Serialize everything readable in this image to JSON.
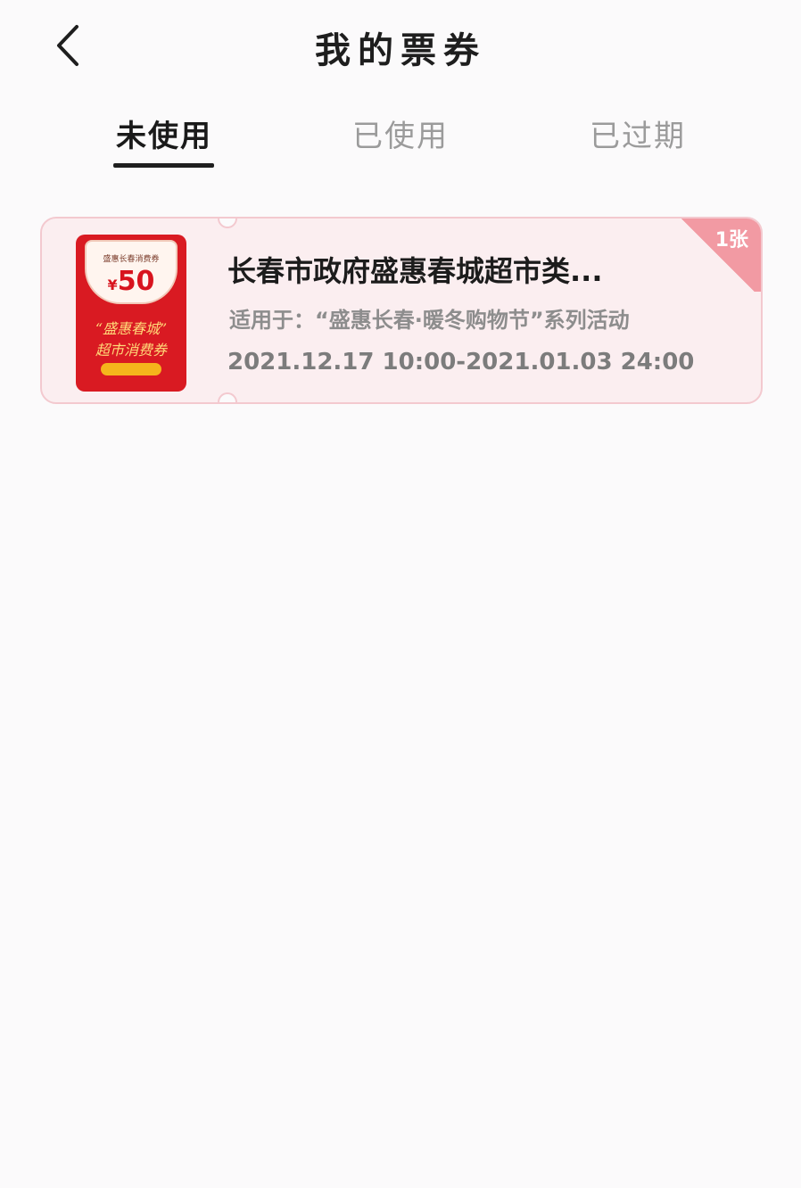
{
  "header": {
    "title": "我的票券",
    "back_icon": "chevron-left-icon"
  },
  "tabs": [
    {
      "label": "未使用",
      "active": true
    },
    {
      "label": "已使用",
      "active": false
    },
    {
      "label": "已过期",
      "active": false
    }
  ],
  "tickets": [
    {
      "title": "长春市政府盛惠春城超市类...",
      "scope_label": "适用于：",
      "scope": "“盛惠长春·暖冬购物节”系列活动",
      "date_range": "2021.12.17 10:00-2021.01.03 24:00",
      "count_badge": "1张",
      "image": {
        "header_text": "盛惠长春消费券",
        "amount": "50",
        "currency": "¥",
        "line1": "“盛惠春城”",
        "line2": "超市消费券"
      }
    }
  ],
  "colors": {
    "background": "#fbfafb",
    "ticket_bg": "#fbeef0",
    "ticket_border": "#f3c9cf",
    "badge": "#f29aa3",
    "envelope_red": "#d91a22"
  }
}
